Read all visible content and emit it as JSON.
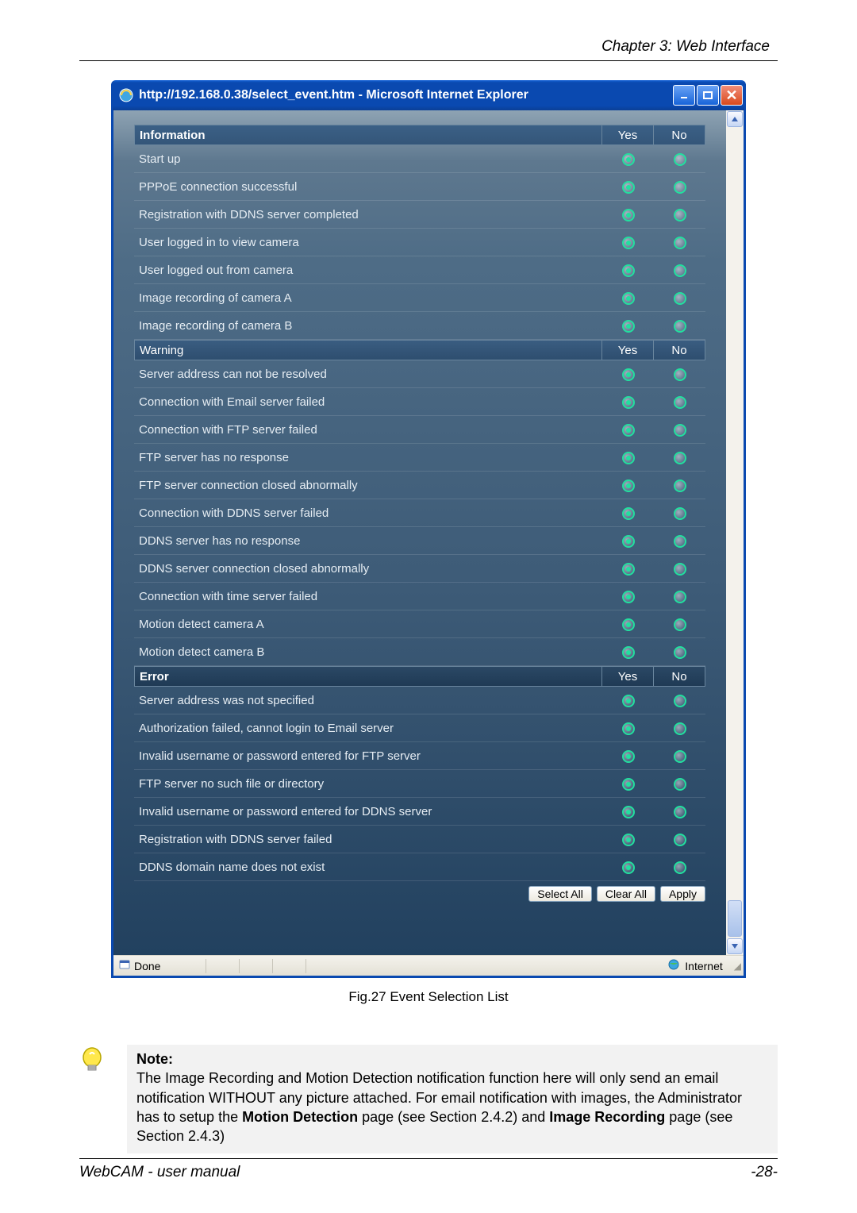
{
  "page": {
    "chapter": "Chapter 3: Web Interface",
    "figure_caption": "Fig.27  Event Selection List",
    "footer_left": "WebCAM - user manual",
    "footer_right": "-28-"
  },
  "window": {
    "title": "http://192.168.0.38/select_event.htm - Microsoft Internet Explorer",
    "status_left": "Done",
    "status_zone": "Internet"
  },
  "headers": {
    "info": "Information",
    "warning": "Warning",
    "error": "Error",
    "yes": "Yes",
    "no": "No"
  },
  "groups": {
    "information": [
      {
        "label": "Start up",
        "selected": "yes"
      },
      {
        "label": "PPPoE connection successful",
        "selected": "yes"
      },
      {
        "label": "Registration with DDNS server completed",
        "selected": "yes"
      },
      {
        "label": "User logged in to view camera",
        "selected": "yes"
      },
      {
        "label": "User logged out from camera",
        "selected": "yes"
      },
      {
        "label": "Image recording of camera A",
        "selected": "yes"
      },
      {
        "label": "Image recording of camera B",
        "selected": "yes"
      }
    ],
    "warning": [
      {
        "label": "Server address can not be resolved",
        "selected": "yes"
      },
      {
        "label": "Connection with Email server failed",
        "selected": "yes"
      },
      {
        "label": "Connection with FTP server failed",
        "selected": "yes"
      },
      {
        "label": "FTP server has no response",
        "selected": "yes"
      },
      {
        "label": "FTP server connection closed abnormally",
        "selected": "yes"
      },
      {
        "label": "Connection with DDNS server failed",
        "selected": "yes"
      },
      {
        "label": "DDNS server has no response",
        "selected": "yes"
      },
      {
        "label": "DDNS server connection closed abnormally",
        "selected": "yes"
      },
      {
        "label": "Connection with time server failed",
        "selected": "yes"
      },
      {
        "label": "Motion detect camera A",
        "selected": "yes"
      },
      {
        "label": "Motion detect camera B",
        "selected": "yes"
      }
    ],
    "error": [
      {
        "label": "Server address was not specified",
        "selected": "yes"
      },
      {
        "label": "Authorization failed, cannot login to Email server",
        "selected": "yes"
      },
      {
        "label": "Invalid username or password entered for FTP server",
        "selected": "yes"
      },
      {
        "label": "FTP server no such file or directory",
        "selected": "yes"
      },
      {
        "label": "Invalid username or password entered for DDNS server",
        "selected": "yes"
      },
      {
        "label": "Registration with DDNS server failed",
        "selected": "yes"
      },
      {
        "label": "DDNS domain name does not exist",
        "selected": "yes"
      }
    ]
  },
  "buttons": {
    "select_all": "Select All",
    "clear_all": "Clear All",
    "apply": "Apply"
  },
  "note": {
    "title": "Note:",
    "line1a": "The Image Recording and Motion Detection notification function here will only send an email notification WITHOUT any picture attached.   For email notification with images, the Administrator has to setup the ",
    "bold1": "Motion Detection",
    "line1b": " page (see Section 2.4.2) and ",
    "bold2": "Image Recording",
    "line1c": " page (see Section 2.4.3)"
  }
}
